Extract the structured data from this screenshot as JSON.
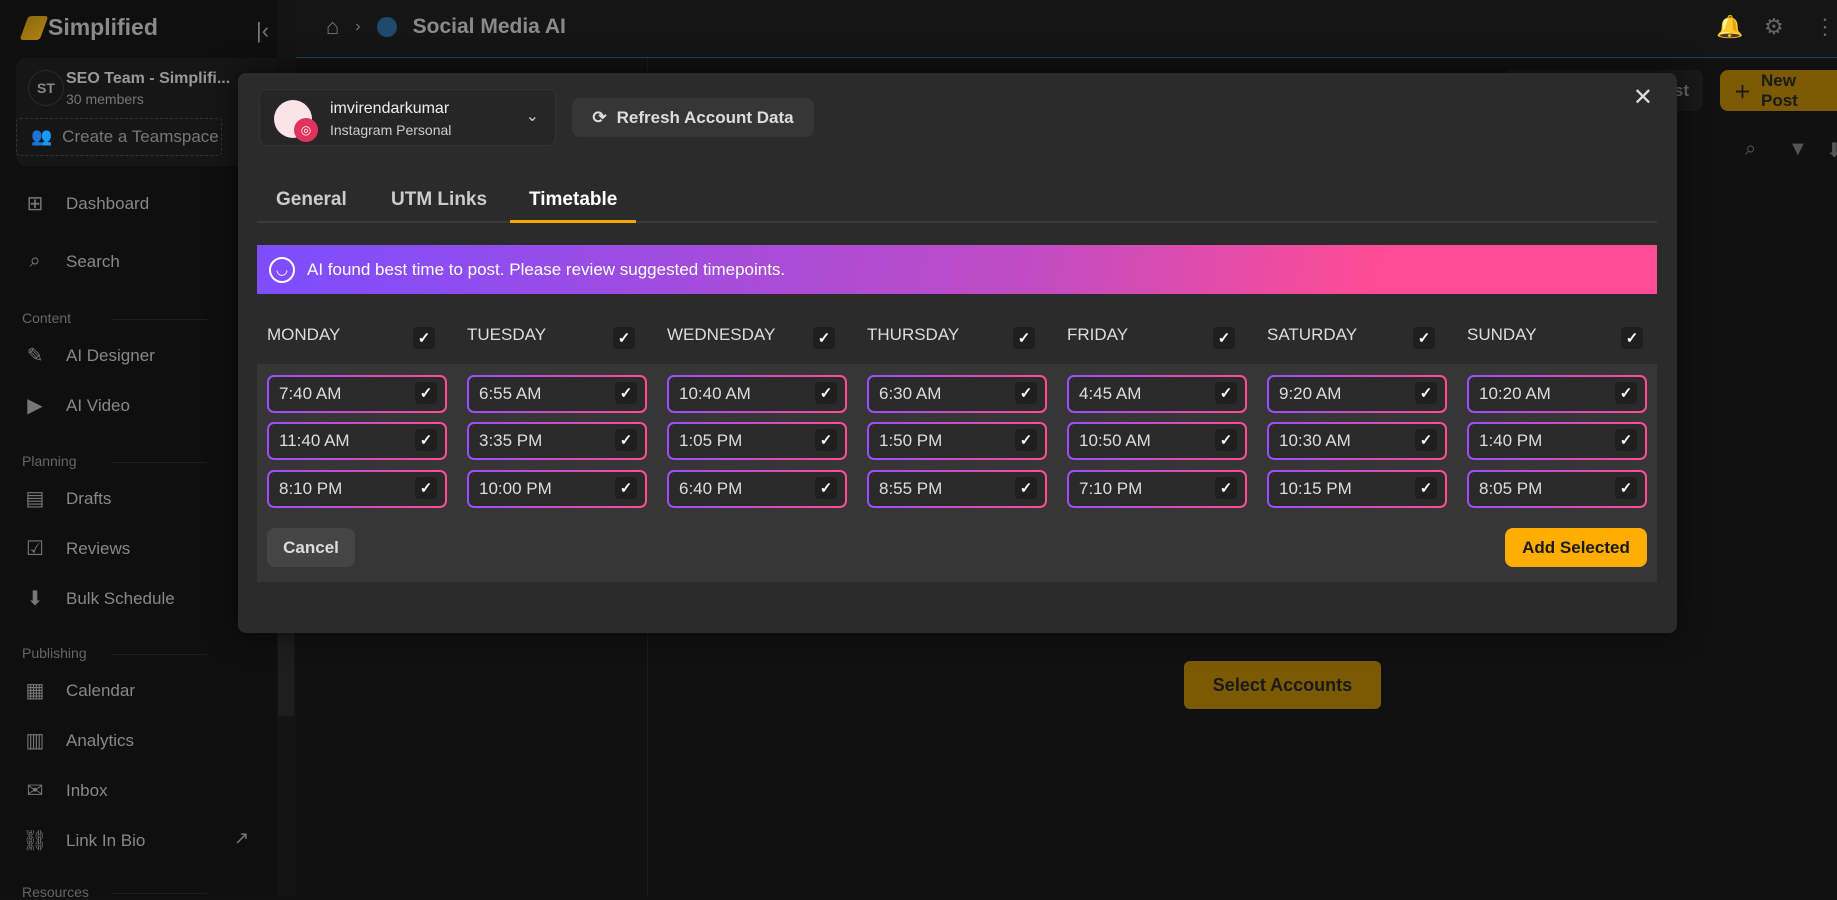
{
  "sidebar": {
    "brand": "Simplified",
    "team": {
      "initials": "ST",
      "name": "SEO Team - Simplifi...",
      "members": "30 members",
      "create_label": "Create a Teamspace"
    },
    "items_top": [
      {
        "label": "Dashboard",
        "icon": "dashboard-icon"
      },
      {
        "label": "Search",
        "icon": "search-icon"
      }
    ],
    "sections": [
      {
        "title": "Content",
        "items": [
          {
            "label": "AI Designer",
            "icon": "designer-icon"
          },
          {
            "label": "AI Video",
            "icon": "video-icon"
          }
        ]
      },
      {
        "title": "Planning",
        "items": [
          {
            "label": "Drafts",
            "icon": "clipboard-icon"
          },
          {
            "label": "Reviews",
            "icon": "review-icon"
          },
          {
            "label": "Bulk Schedule",
            "icon": "download-icon"
          }
        ]
      },
      {
        "title": "Publishing",
        "items": [
          {
            "label": "Calendar",
            "icon": "calendar-icon"
          },
          {
            "label": "Analytics",
            "icon": "chart-icon"
          },
          {
            "label": "Inbox",
            "icon": "inbox-icon"
          },
          {
            "label": "Link In Bio",
            "icon": "link-icon"
          }
        ]
      },
      {
        "title": "Resources",
        "items": []
      }
    ]
  },
  "header": {
    "title": "Social Media AI"
  },
  "toolbar": {
    "partial_button": "st",
    "new_post": "New Post"
  },
  "main": {
    "select_accounts": "Select Accounts"
  },
  "modal": {
    "account": {
      "username": "imvirendarkumar",
      "type": "Instagram Personal"
    },
    "refresh_label": "Refresh Account Data",
    "tabs": [
      {
        "label": "General"
      },
      {
        "label": "UTM Links"
      },
      {
        "label": "Timetable",
        "active": true
      }
    ],
    "banner": "AI found best time to post. Please review suggested timepoints.",
    "days": [
      {
        "name": "MONDAY",
        "checked": true,
        "times": [
          "7:40 AM",
          "11:40 AM",
          "8:10 PM"
        ]
      },
      {
        "name": "TUESDAY",
        "checked": true,
        "times": [
          "6:55 AM",
          "3:35 PM",
          "10:00 PM"
        ]
      },
      {
        "name": "WEDNESDAY",
        "checked": true,
        "times": [
          "10:40 AM",
          "1:05 PM",
          "6:40 PM"
        ]
      },
      {
        "name": "THURSDAY",
        "checked": true,
        "times": [
          "6:30 AM",
          "1:50 PM",
          "8:55 PM"
        ]
      },
      {
        "name": "FRIDAY",
        "checked": true,
        "times": [
          "4:45 AM",
          "10:50 AM",
          "7:10 PM"
        ]
      },
      {
        "name": "SATURDAY",
        "checked": true,
        "times": [
          "9:20 AM",
          "10:30 AM",
          "10:15 PM"
        ]
      },
      {
        "name": "SUNDAY",
        "checked": true,
        "times": [
          "10:20 AM",
          "1:40 PM",
          "8:05 PM"
        ]
      }
    ],
    "cancel_label": "Cancel",
    "add_label": "Add Selected"
  },
  "colors": {
    "accent": "#ffad00",
    "banner_start": "#7c4dff",
    "banner_end": "#ff4c94"
  }
}
